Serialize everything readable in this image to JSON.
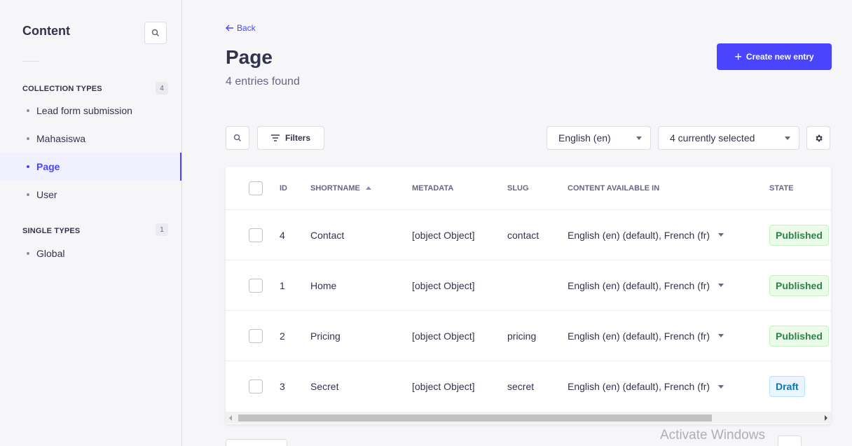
{
  "sidebar": {
    "title": "Content",
    "collection_types": {
      "label": "COLLECTION TYPES",
      "count": "4",
      "items": [
        {
          "label": "Lead form submission"
        },
        {
          "label": "Mahasiswa"
        },
        {
          "label": "Page"
        },
        {
          "label": "User"
        }
      ]
    },
    "single_types": {
      "label": "SINGLE TYPES",
      "count": "1",
      "items": [
        {
          "label": "Global"
        }
      ]
    },
    "active_item": "Page"
  },
  "header": {
    "back_label": "Back",
    "title": "Page",
    "subtitle": "4 entries found",
    "create_label": "Create new entry"
  },
  "toolbar": {
    "filters_label": "Filters",
    "locale_value": "English (en)",
    "columns_value": "4 currently selected"
  },
  "table": {
    "headers": {
      "id": "ID",
      "shortname": "SHORTNAME",
      "metadata": "METADATA",
      "slug": "SLUG",
      "content_available_in": "CONTENT AVAILABLE IN",
      "state": "STATE"
    },
    "rows": [
      {
        "id": "4",
        "shortname": "Contact",
        "metadata": "[object Object]",
        "slug": "contact",
        "langs": "English (en) (default), French (fr)",
        "state": "Published"
      },
      {
        "id": "1",
        "shortname": "Home",
        "metadata": "[object Object]",
        "slug": "",
        "langs": "English (en) (default), French (fr)",
        "state": "Published"
      },
      {
        "id": "2",
        "shortname": "Pricing",
        "metadata": "[object Object]",
        "slug": "pricing",
        "langs": "English (en) (default), French (fr)",
        "state": "Published"
      },
      {
        "id": "3",
        "shortname": "Secret",
        "metadata": "[object Object]",
        "slug": "secret",
        "langs": "English (en) (default), French (fr)",
        "state": "Draft"
      }
    ]
  },
  "watermark": "Activate Windows",
  "colors": {
    "primary": "#4945ff",
    "published_bg": "#eafbe7",
    "published_text": "#328048",
    "draft_bg": "#eaf5ff",
    "draft_text": "#0c75af"
  }
}
